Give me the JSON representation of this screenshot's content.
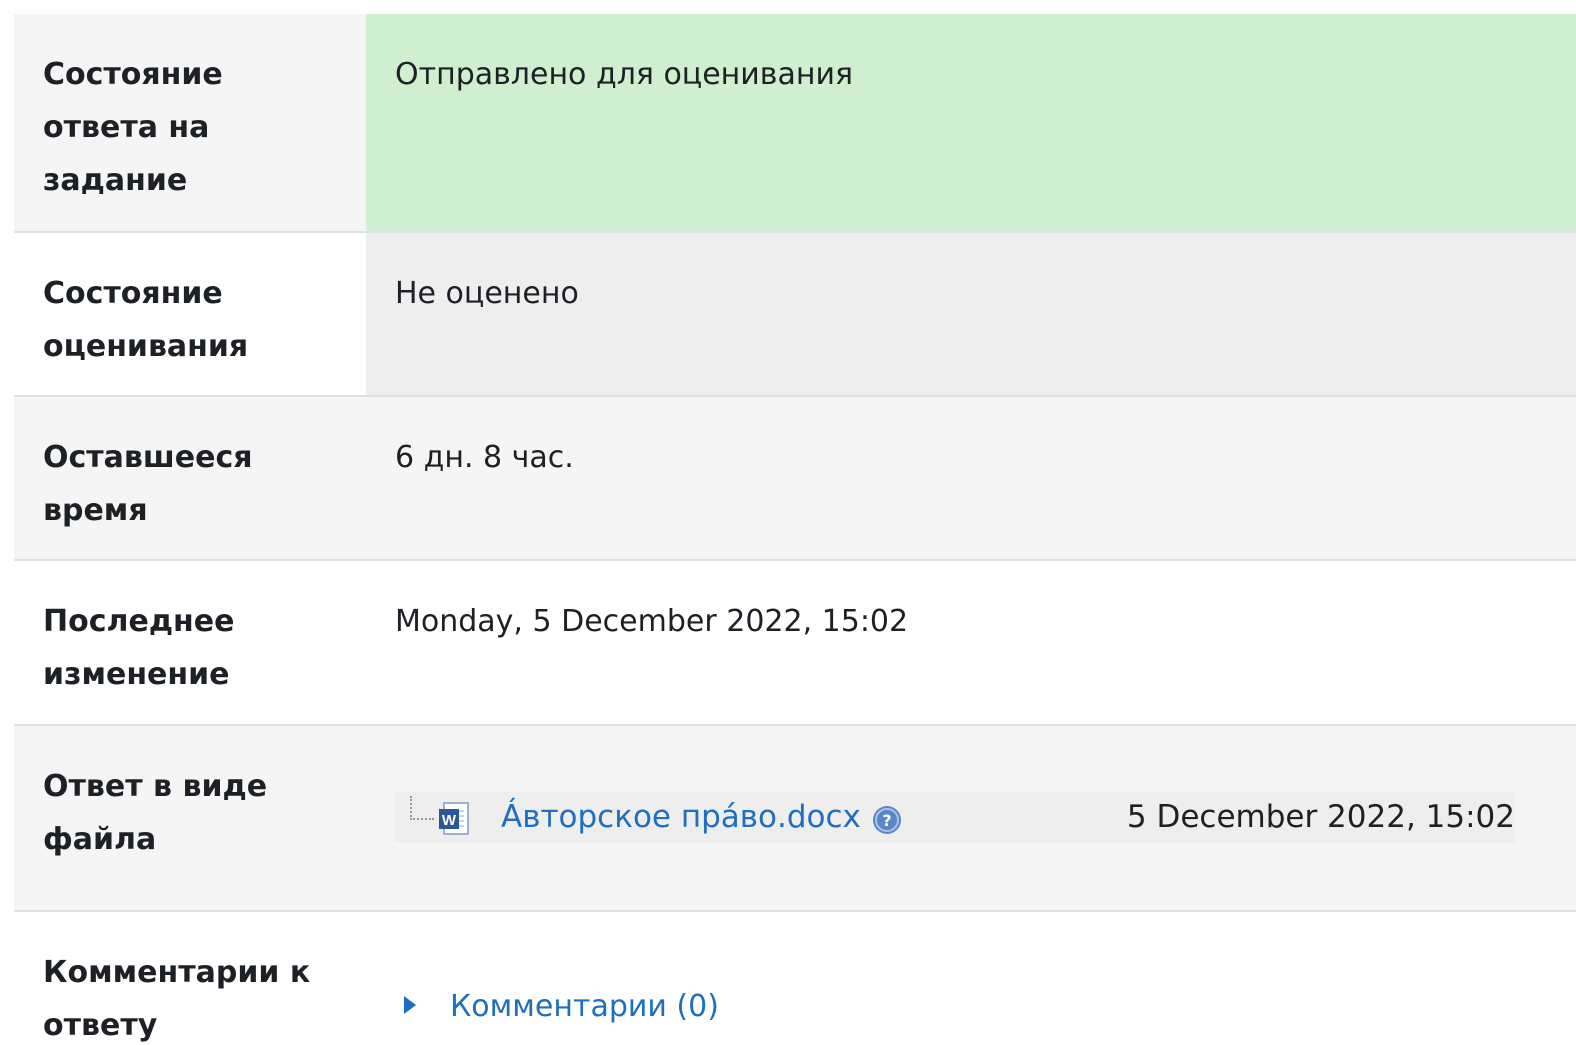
{
  "rows": [
    {
      "label": "Состояние ответа на задание",
      "value": "Отправлено для оценивания"
    },
    {
      "label": "Состояние оценивания",
      "value": "Не оценено"
    },
    {
      "label": "Оставшееся время",
      "value": "6 дн. 8 час."
    },
    {
      "label": "Последнее изменение",
      "value": "Monday, 5 December 2022, 15:02"
    },
    {
      "label": "Ответ в виде файла"
    },
    {
      "label": "Комментарии к ответу"
    }
  ],
  "file": {
    "name": "Áвторское прáво.docx",
    "date": "5 December 2022, 15:02",
    "icon": "word-document-icon"
  },
  "comments": {
    "link": "Комментарии (0)"
  },
  "colors": {
    "submitted_bg": "#cfefd0",
    "link": "#1f6fc0"
  }
}
